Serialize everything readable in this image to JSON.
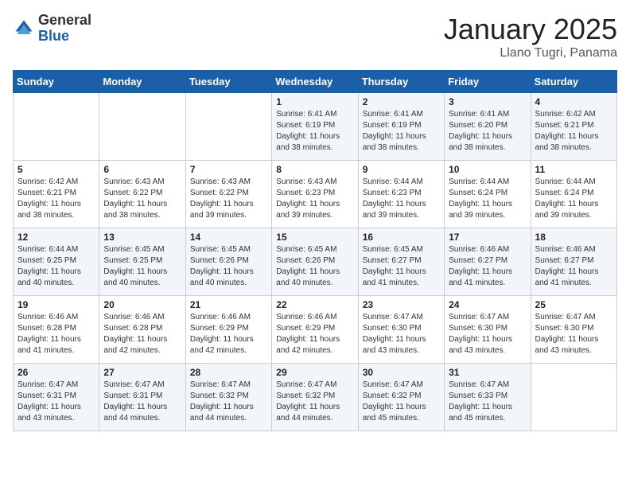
{
  "header": {
    "logo_general": "General",
    "logo_blue": "Blue",
    "title": "January 2025",
    "location": "Llano Tugri, Panama"
  },
  "days_of_week": [
    "Sunday",
    "Monday",
    "Tuesday",
    "Wednesday",
    "Thursday",
    "Friday",
    "Saturday"
  ],
  "weeks": [
    [
      {
        "day": "",
        "info": ""
      },
      {
        "day": "",
        "info": ""
      },
      {
        "day": "",
        "info": ""
      },
      {
        "day": "1",
        "info": "Sunrise: 6:41 AM\nSunset: 6:19 PM\nDaylight: 11 hours\nand 38 minutes."
      },
      {
        "day": "2",
        "info": "Sunrise: 6:41 AM\nSunset: 6:19 PM\nDaylight: 11 hours\nand 38 minutes."
      },
      {
        "day": "3",
        "info": "Sunrise: 6:41 AM\nSunset: 6:20 PM\nDaylight: 11 hours\nand 38 minutes."
      },
      {
        "day": "4",
        "info": "Sunrise: 6:42 AM\nSunset: 6:21 PM\nDaylight: 11 hours\nand 38 minutes."
      }
    ],
    [
      {
        "day": "5",
        "info": "Sunrise: 6:42 AM\nSunset: 6:21 PM\nDaylight: 11 hours\nand 38 minutes."
      },
      {
        "day": "6",
        "info": "Sunrise: 6:43 AM\nSunset: 6:22 PM\nDaylight: 11 hours\nand 38 minutes."
      },
      {
        "day": "7",
        "info": "Sunrise: 6:43 AM\nSunset: 6:22 PM\nDaylight: 11 hours\nand 39 minutes."
      },
      {
        "day": "8",
        "info": "Sunrise: 6:43 AM\nSunset: 6:23 PM\nDaylight: 11 hours\nand 39 minutes."
      },
      {
        "day": "9",
        "info": "Sunrise: 6:44 AM\nSunset: 6:23 PM\nDaylight: 11 hours\nand 39 minutes."
      },
      {
        "day": "10",
        "info": "Sunrise: 6:44 AM\nSunset: 6:24 PM\nDaylight: 11 hours\nand 39 minutes."
      },
      {
        "day": "11",
        "info": "Sunrise: 6:44 AM\nSunset: 6:24 PM\nDaylight: 11 hours\nand 39 minutes."
      }
    ],
    [
      {
        "day": "12",
        "info": "Sunrise: 6:44 AM\nSunset: 6:25 PM\nDaylight: 11 hours\nand 40 minutes."
      },
      {
        "day": "13",
        "info": "Sunrise: 6:45 AM\nSunset: 6:25 PM\nDaylight: 11 hours\nand 40 minutes."
      },
      {
        "day": "14",
        "info": "Sunrise: 6:45 AM\nSunset: 6:26 PM\nDaylight: 11 hours\nand 40 minutes."
      },
      {
        "day": "15",
        "info": "Sunrise: 6:45 AM\nSunset: 6:26 PM\nDaylight: 11 hours\nand 40 minutes."
      },
      {
        "day": "16",
        "info": "Sunrise: 6:45 AM\nSunset: 6:27 PM\nDaylight: 11 hours\nand 41 minutes."
      },
      {
        "day": "17",
        "info": "Sunrise: 6:46 AM\nSunset: 6:27 PM\nDaylight: 11 hours\nand 41 minutes."
      },
      {
        "day": "18",
        "info": "Sunrise: 6:46 AM\nSunset: 6:27 PM\nDaylight: 11 hours\nand 41 minutes."
      }
    ],
    [
      {
        "day": "19",
        "info": "Sunrise: 6:46 AM\nSunset: 6:28 PM\nDaylight: 11 hours\nand 41 minutes."
      },
      {
        "day": "20",
        "info": "Sunrise: 6:46 AM\nSunset: 6:28 PM\nDaylight: 11 hours\nand 42 minutes."
      },
      {
        "day": "21",
        "info": "Sunrise: 6:46 AM\nSunset: 6:29 PM\nDaylight: 11 hours\nand 42 minutes."
      },
      {
        "day": "22",
        "info": "Sunrise: 6:46 AM\nSunset: 6:29 PM\nDaylight: 11 hours\nand 42 minutes."
      },
      {
        "day": "23",
        "info": "Sunrise: 6:47 AM\nSunset: 6:30 PM\nDaylight: 11 hours\nand 43 minutes."
      },
      {
        "day": "24",
        "info": "Sunrise: 6:47 AM\nSunset: 6:30 PM\nDaylight: 11 hours\nand 43 minutes."
      },
      {
        "day": "25",
        "info": "Sunrise: 6:47 AM\nSunset: 6:30 PM\nDaylight: 11 hours\nand 43 minutes."
      }
    ],
    [
      {
        "day": "26",
        "info": "Sunrise: 6:47 AM\nSunset: 6:31 PM\nDaylight: 11 hours\nand 43 minutes."
      },
      {
        "day": "27",
        "info": "Sunrise: 6:47 AM\nSunset: 6:31 PM\nDaylight: 11 hours\nand 44 minutes."
      },
      {
        "day": "28",
        "info": "Sunrise: 6:47 AM\nSunset: 6:32 PM\nDaylight: 11 hours\nand 44 minutes."
      },
      {
        "day": "29",
        "info": "Sunrise: 6:47 AM\nSunset: 6:32 PM\nDaylight: 11 hours\nand 44 minutes."
      },
      {
        "day": "30",
        "info": "Sunrise: 6:47 AM\nSunset: 6:32 PM\nDaylight: 11 hours\nand 45 minutes."
      },
      {
        "day": "31",
        "info": "Sunrise: 6:47 AM\nSunset: 6:33 PM\nDaylight: 11 hours\nand 45 minutes."
      },
      {
        "day": "",
        "info": ""
      }
    ]
  ]
}
